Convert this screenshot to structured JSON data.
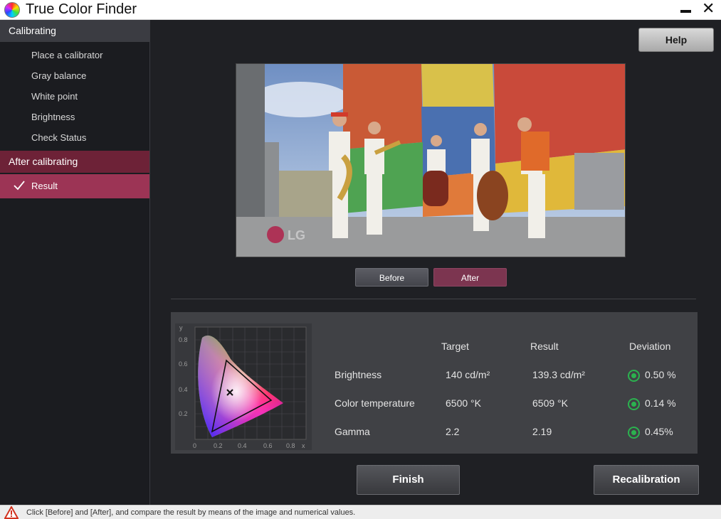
{
  "window": {
    "title": "True Color Finder",
    "minimize_icon": "minimize-icon",
    "close_icon": "close-icon"
  },
  "sidebar": {
    "section1": "Calibrating",
    "items": [
      "Place a calibrator",
      "Gray balance",
      "White point",
      "Brightness",
      "Check Status"
    ],
    "section2": "After calibrating",
    "result": "Result",
    "active_color": "#9c3455"
  },
  "help_label": "Help",
  "preview": {
    "watermark": "LG"
  },
  "toggle": {
    "before": "Before",
    "after": "After",
    "selected": "After"
  },
  "chart": {
    "y_label": "y",
    "x_label": "x",
    "y_ticks": [
      "0.8",
      "0.6",
      "0.4",
      "0.2"
    ],
    "x_ticks": [
      "0",
      "0.2",
      "0.4",
      "0.6",
      "0.8"
    ]
  },
  "results": {
    "headers": {
      "target": "Target",
      "result": "Result",
      "deviation": "Deviation"
    },
    "rows": [
      {
        "label": "Brightness",
        "target": "140 cd/m²",
        "result": "139.3 cd/m²",
        "deviation": "0.50 %"
      },
      {
        "label": "Color temperature",
        "target": "6500 °K",
        "result": "6509 °K",
        "deviation": "0.14 %"
      },
      {
        "label": "Gamma",
        "target": "2.2",
        "result": "2.19",
        "deviation": "0.45%"
      }
    ],
    "ok_color": "#2bb24f"
  },
  "buttons": {
    "finish": "Finish",
    "recalibration": "Recalibration"
  },
  "status": "Click [Before] and [After], and compare the result by means of the image and numerical values."
}
